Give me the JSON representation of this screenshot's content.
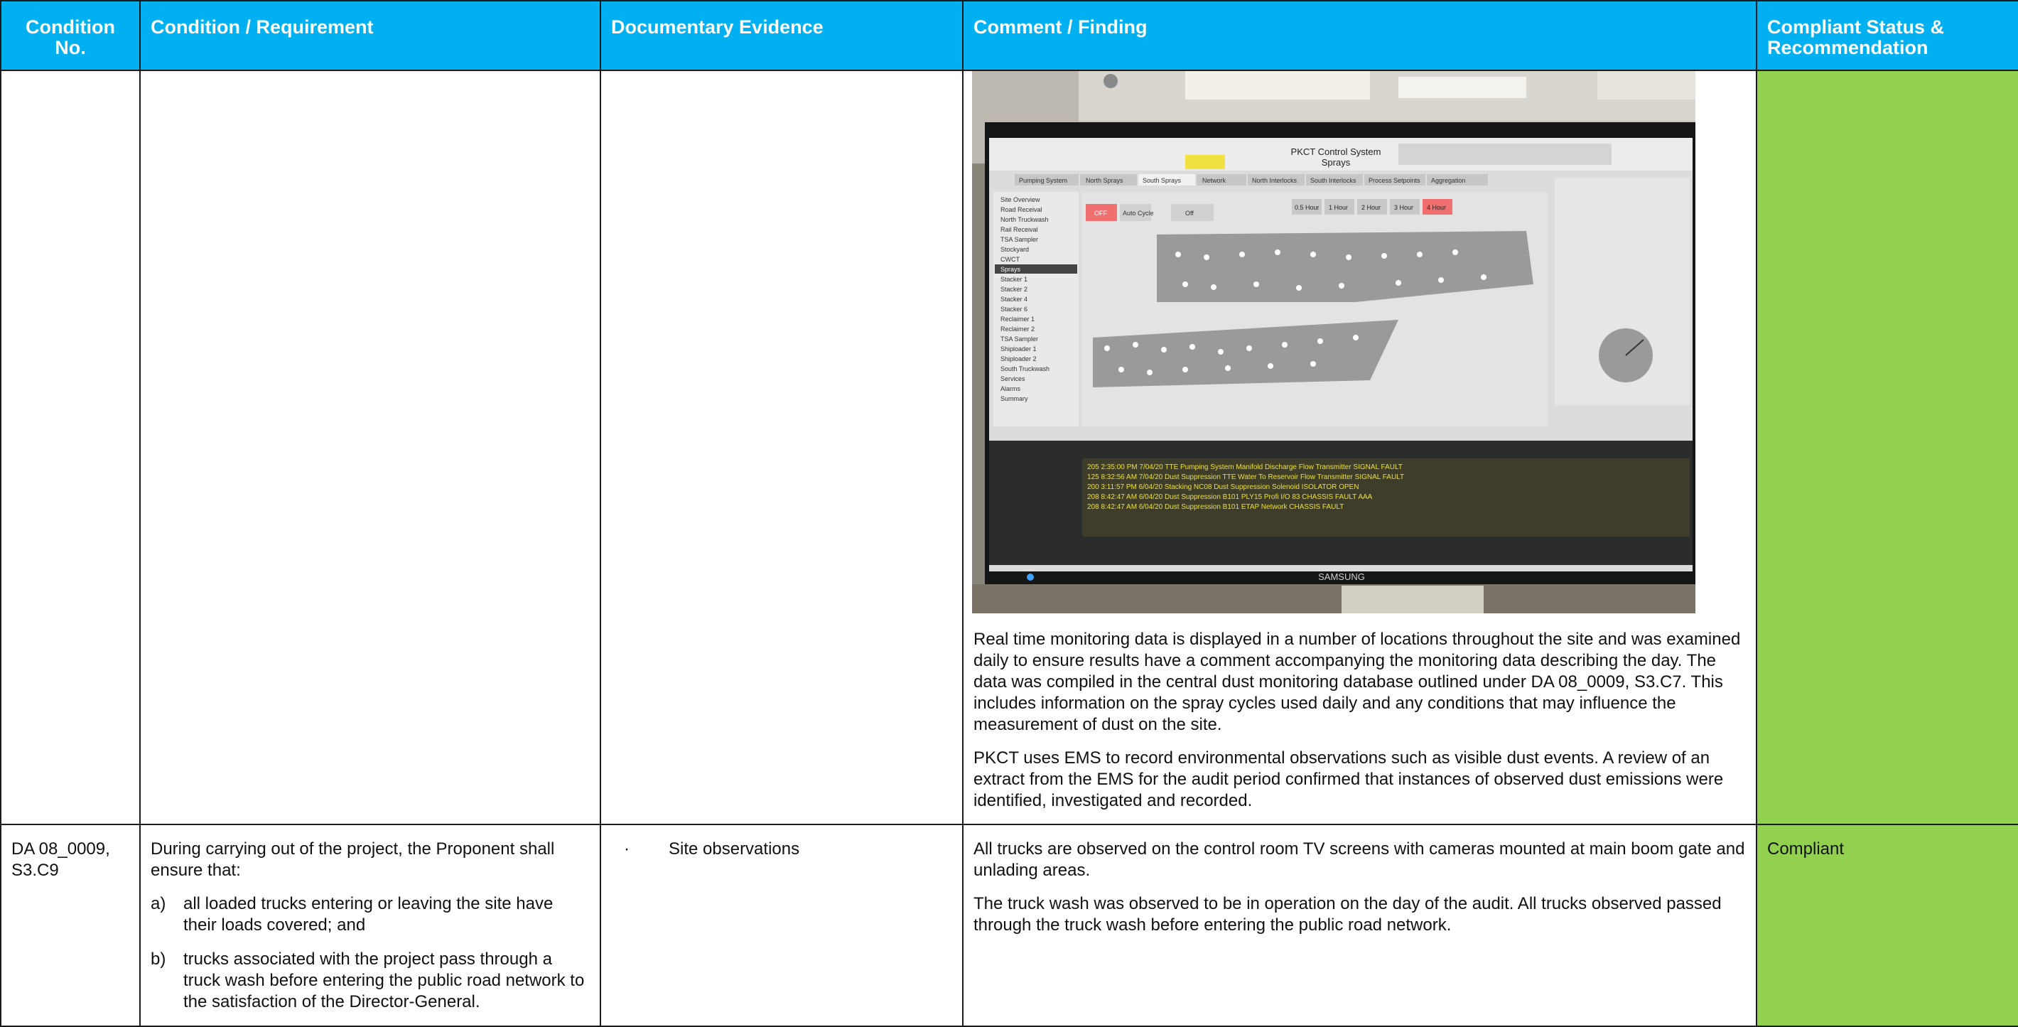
{
  "table": {
    "headers": [
      "Condition No.",
      "Condition / Requirement",
      "Documentary Evidence",
      "Comment / Finding",
      "Compliant Status & Recommendation"
    ]
  },
  "row1": {
    "photo": {
      "screen_title": "PKCT Control System",
      "screen_subtitle": "Sprays",
      "monitor_brand": "SAMSUNG",
      "tabs": [
        "Pumping System",
        "North Sprays",
        "South Sprays",
        "Network",
        "North Interlocks",
        "South Interlocks",
        "Process Setpoints",
        "Aggregation"
      ],
      "nav_items": [
        "Site Overview",
        "Road Receival",
        "North Truckwash",
        "Rail Receival",
        "TSA Sampler",
        "Stockyard",
        "CWCT",
        "Sprays",
        "Stacker 1",
        "Stacker 2",
        "Stacker 4",
        "Stacker 6",
        "Reclaimer 1",
        "Reclaimer 2",
        "TSA Sampler",
        "Shiploader 1",
        "Shiploader 2",
        "South Truckwash",
        "Services",
        "Alarms",
        "Summary"
      ],
      "cycle_buttons": [
        "0.5 Hour",
        "1 Hour",
        "2 Hour",
        "3 Hour",
        "4 Hour"
      ],
      "master_mode": [
        "OFF",
        "Auto Cycle",
        "Off"
      ],
      "alarm_rows": [
        "205 2:35:00 PM 7/04/20 TTE Pumping System Manifold Discharge Flow Transmitter SIGNAL FAULT",
        "125 8:32:56 AM 7/04/20 Dust Suppression TTE Water To Reservoir Flow Transmitter SIGNAL FAULT",
        "200 3:11:57 PM 6/04/20 Stacking NC08 Dust Suppression Solenoid ISOLATOR OPEN",
        "208 8:42:47 AM 6/04/20 Dust Suppression B101 PLY15 Profi I/O 83 CHASSIS FAULT AAA",
        "208 8:42:47 AM 6/04/20 Dust Suppression B101 ETAP Network CHASSIS FAULT"
      ]
    },
    "findings": [
      "Real time monitoring data is displayed in a number of locations throughout the site and was examined daily to ensure results have a comment accompanying the monitoring data describing the day. The data was compiled in the central dust monitoring database outlined under DA 08_0009, S3.C7. This includes information on the spray cycles used daily and any conditions that may influence the measurement of dust on the site.",
      "PKCT uses EMS to record environmental observations such as visible dust events.  A review of an extract from the EMS for the audit period confirmed that instances of observed dust emissions were identified, investigated and recorded."
    ]
  },
  "row2": {
    "condition_no": "DA 08_0009, S3.C9",
    "requirement_intro": "During carrying out of the project, the Proponent shall ensure that:",
    "requirement_items": [
      {
        "marker": "a)",
        "text": "all loaded trucks entering or leaving the site have their loads covered; and"
      },
      {
        "marker": "b)",
        "text": "trucks associated with the project pass through a truck wash before entering the public road network to the satisfaction of the Director-General."
      }
    ],
    "evidence_bullet": "·",
    "evidence": "Site observations",
    "findings": [
      "All trucks are observed on the control room TV screens with cameras mounted at main boom gate and unlading areas.",
      "The truck wash was observed to be in operation on the day of the audit. All trucks observed passed through the truck wash before entering the public road network."
    ],
    "status": "Compliant"
  },
  "colors": {
    "header_bg": "#00b0f0",
    "header_text": "#ffffff",
    "status_bg": "#92d050",
    "border": "#1a1a1a"
  }
}
